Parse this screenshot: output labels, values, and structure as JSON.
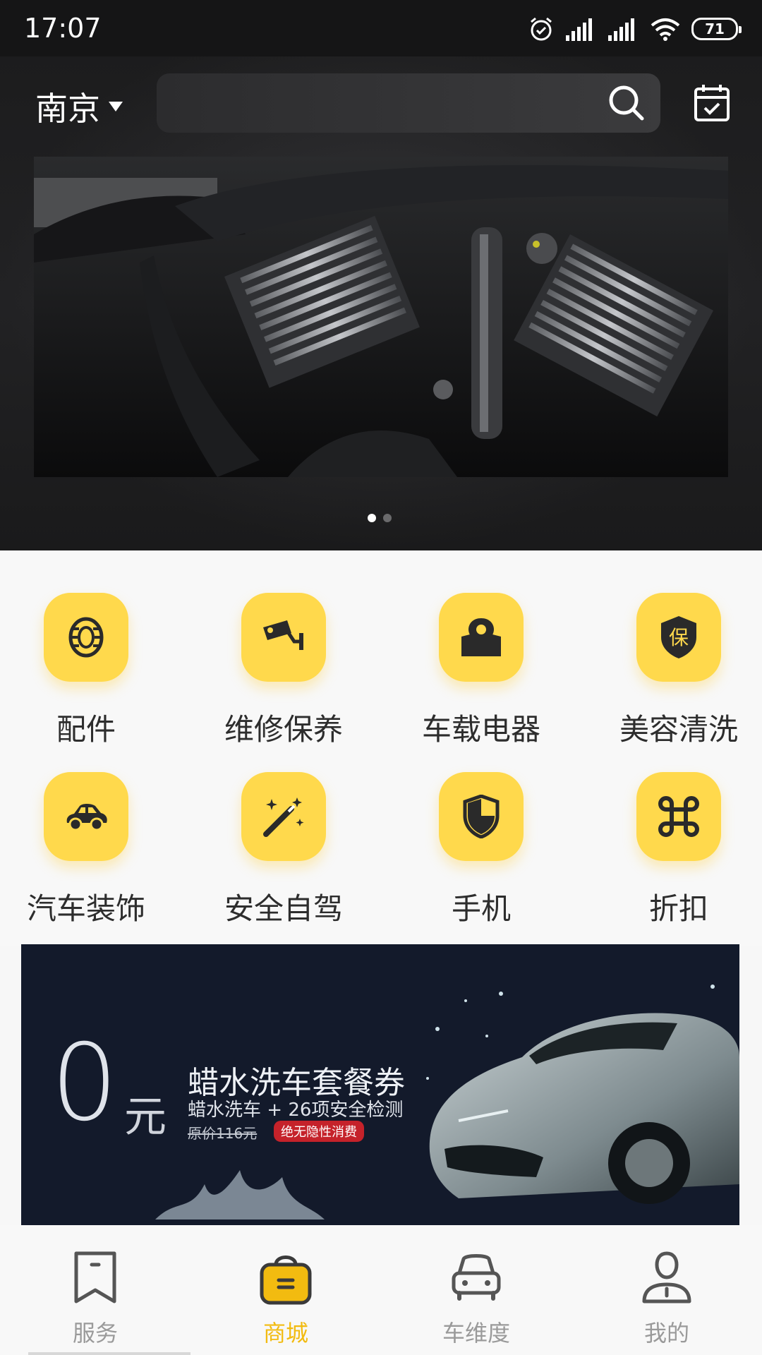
{
  "status_bar": {
    "time": "17:07",
    "battery": "71"
  },
  "header": {
    "city": "南京",
    "search_placeholder": ""
  },
  "banner": {
    "slides": 2,
    "active_slide": 1
  },
  "categories": [
    {
      "label": "配件",
      "icon": "tire-icon"
    },
    {
      "label": "维修保养",
      "icon": "camera-icon"
    },
    {
      "label": "车载电器",
      "icon": "map-pin-icon"
    },
    {
      "label": "美容清洗",
      "icon": "shield-bao-icon"
    },
    {
      "label": "汽车装饰",
      "icon": "car-icon"
    },
    {
      "label": "安全自驾",
      "icon": "magic-wand-icon"
    },
    {
      "label": "手机",
      "icon": "shield-icon"
    },
    {
      "label": "折扣",
      "icon": "command-icon"
    }
  ],
  "promo": {
    "zero": "0",
    "yuan": "元",
    "title": "蜡水洗车套餐券",
    "subtitle": "蜡水洗车 + 26项安全检测",
    "original_price": "原价116元",
    "badge": "绝无隐性消费"
  },
  "bottom_nav": [
    {
      "label": "服务",
      "icon": "bookmark-icon",
      "active": false
    },
    {
      "label": "商城",
      "icon": "shopping-bag-icon",
      "active": true
    },
    {
      "label": "车维度",
      "icon": "car-front-icon",
      "active": false
    },
    {
      "label": "我的",
      "icon": "person-icon",
      "active": false
    }
  ],
  "colors": {
    "accent": "#ffd94c",
    "active_nav": "#f2bb10",
    "header_bg": "#1b1b1c"
  }
}
